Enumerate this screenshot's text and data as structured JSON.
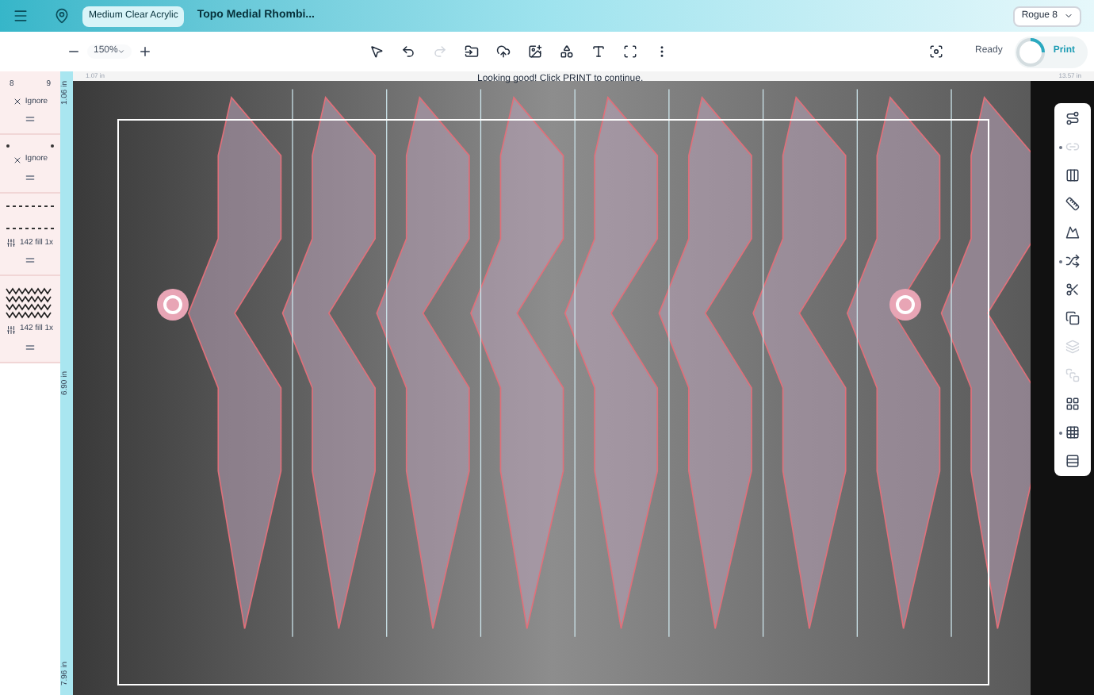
{
  "header": {
    "material_tab": {
      "label": "Medium Clear Acrylic",
      "selected": true
    },
    "design_title": "Topo Medial Rhombi...",
    "machine_select": {
      "value": "Rogue 8"
    }
  },
  "toolbar": {
    "zoom": "150%",
    "tools": [
      {
        "disabled": false
      },
      {
        "disabled": false
      },
      {
        "disabled": true
      },
      {
        "disabled": false
      },
      {
        "disabled": false
      },
      {
        "disabled": false
      },
      {
        "disabled": false
      },
      {
        "disabled": false
      },
      {
        "disabled": false
      },
      {
        "disabled": false
      }
    ],
    "status": "Ready",
    "print_button": "Print"
  },
  "sidebar": {
    "items": [
      {
        "kind": "points",
        "marks": [
          "8",
          "9"
        ],
        "action": {
          "kind": "ignore",
          "label": "Ignore"
        }
      },
      {
        "kind": "dots",
        "action": {
          "kind": "ignore",
          "label": "Ignore"
        }
      },
      {
        "kind": "dashes",
        "action": {
          "kind": "fill",
          "label": "142 fill 1x"
        }
      },
      {
        "kind": "pattern",
        "action": {
          "kind": "fill",
          "label": "142 fill 1x"
        }
      }
    ]
  },
  "canvas": {
    "message": "Looking good! Click PRINT to continue.",
    "top_ruler": [
      "1.07 in",
      "13.57 in"
    ],
    "side_ruler": [
      "1.06 in",
      "6.90 in",
      "7.96 in"
    ]
  },
  "right_tools": [
    {
      "disabled": false,
      "expandable": false
    },
    {
      "disabled": true,
      "expandable": true
    },
    {
      "disabled": false,
      "expandable": false
    },
    {
      "disabled": false,
      "expandable": false
    },
    {
      "disabled": false,
      "expandable": false
    },
    {
      "disabled": false,
      "expandable": true
    },
    {
      "disabled": false,
      "expandable": false
    },
    {
      "disabled": false,
      "expandable": false
    },
    {
      "disabled": true,
      "expandable": false
    },
    {
      "disabled": true,
      "expandable": false
    },
    {
      "disabled": false,
      "expandable": false
    },
    {
      "disabled": false,
      "expandable": true
    },
    {
      "disabled": false,
      "expandable": false
    }
  ]
}
